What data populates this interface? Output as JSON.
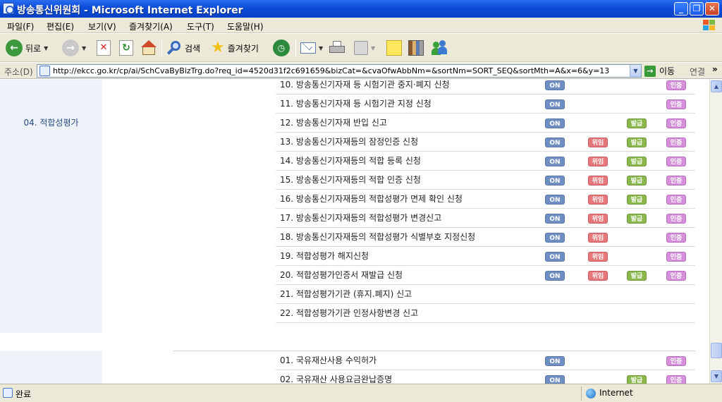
{
  "window": {
    "title": "방송통신위원회 - Microsoft Internet Explorer",
    "min_glyph": "_",
    "max_glyph": "❐",
    "close_glyph": "✕"
  },
  "menu": [
    "파일(F)",
    "편집(E)",
    "보기(V)",
    "즐겨찾기(A)",
    "도구(T)",
    "도움말(H)"
  ],
  "toolbar": {
    "back": "뒤로",
    "search": "검색",
    "favorites": "즐겨찾기"
  },
  "address": {
    "label": "주소(D)",
    "url": "http://ekcc.go.kr/cp/ai/SchCvaByBizTrg.do?req_id=4520d31f2c691659&bizCat=&cvaOfwAbbNm=&sortNm=SORT_SEQ&sortMth=A&x=6&y=13",
    "go_label": "이동",
    "links_label": "연결"
  },
  "badges": {
    "on": "ON",
    "wi": "위임",
    "bal": "발급",
    "in": "인증"
  },
  "section1": {
    "category": "04. 적합성평가",
    "rows": [
      {
        "name": "10. 방송통신기자재 등 시험기관 중지·폐지 신청",
        "on": true,
        "wi": false,
        "bal": false,
        "in": true
      },
      {
        "name": "11. 방송통신기자재 등 시험기관 지정 신청",
        "on": true,
        "wi": false,
        "bal": false,
        "in": true
      },
      {
        "name": "12. 방송통신기자재 반입 신고",
        "on": true,
        "wi": false,
        "bal": true,
        "in": true
      },
      {
        "name": "13. 방송통신기자재등의 잠정인증 신청",
        "on": true,
        "wi": true,
        "bal": true,
        "in": true
      },
      {
        "name": "14. 방송통신기자재등의 적합 등록 신청",
        "on": true,
        "wi": true,
        "bal": true,
        "in": true
      },
      {
        "name": "15. 방송통신기자재등의 적합 인증 신청",
        "on": true,
        "wi": true,
        "bal": true,
        "in": true
      },
      {
        "name": "16. 방송통신기자재등의 적합성평가 면제 확인 신청",
        "on": true,
        "wi": true,
        "bal": true,
        "in": true
      },
      {
        "name": "17. 방송통신기자재등의 적합성평가 변경신고",
        "on": true,
        "wi": true,
        "bal": true,
        "in": true
      },
      {
        "name": "18. 방송통신기자재등의 적합성평가 식별부호 지정신청",
        "on": true,
        "wi": true,
        "bal": false,
        "in": true
      },
      {
        "name": "19. 적합성평가 해지신청",
        "on": true,
        "wi": true,
        "bal": false,
        "in": true
      },
      {
        "name": "20. 적합성평가인증서 재발급 신청",
        "on": true,
        "wi": true,
        "bal": true,
        "in": true
      },
      {
        "name": "21. 적합성평가기관 (휴지.폐지) 신고",
        "on": false,
        "wi": false,
        "bal": false,
        "in": false
      },
      {
        "name": "22. 적합성평가기관 인정사항변경 신고",
        "on": false,
        "wi": false,
        "bal": false,
        "in": false
      }
    ]
  },
  "section2": {
    "rows": [
      {
        "name": "01. 국유재산사용 수익허가",
        "on": true,
        "wi": false,
        "bal": false,
        "in": true
      },
      {
        "name": "02. 국유재산 사용요금완납증명",
        "on": true,
        "wi": false,
        "bal": true,
        "in": true
      }
    ]
  },
  "status": {
    "text": "완료",
    "zone": "Internet"
  }
}
